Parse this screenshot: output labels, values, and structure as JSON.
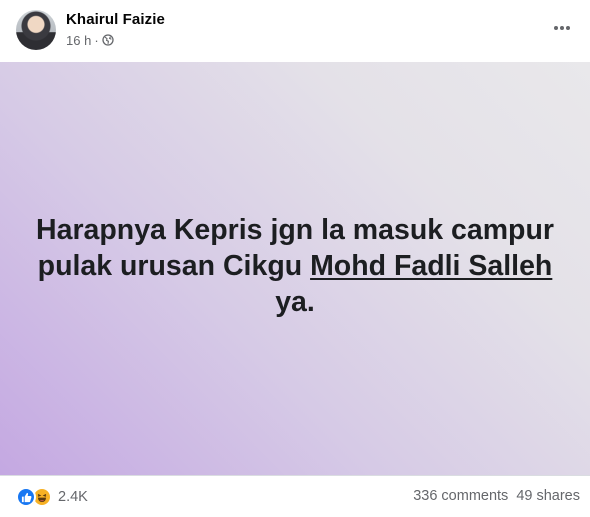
{
  "post": {
    "author": "Khairul Faizie",
    "time": "16 h",
    "separator": "·",
    "privacy_icon": "globe-icon",
    "more_icon": "more-horizontal-icon",
    "text_line_1": "Harapnya Kepris jgn la masuk campur",
    "text_line_2_prefix": "pulak urusan Cikgu ",
    "mention": "Mohd Fadli Salleh",
    "text_line_3": "ya.",
    "background_gradient": [
      "#c4a8e2",
      "#e9e8eb"
    ],
    "text_color": "#1c1e21"
  },
  "footer": {
    "reaction_icons": [
      "like-reaction-icon",
      "haha-reaction-icon"
    ],
    "reaction_count": "2.4K",
    "comments": "336 comments",
    "shares": "49 shares"
  },
  "colors": {
    "like_blue": "#1877f2",
    "haha_yellow": "#f7b125",
    "secondary_text": "#65676b"
  }
}
